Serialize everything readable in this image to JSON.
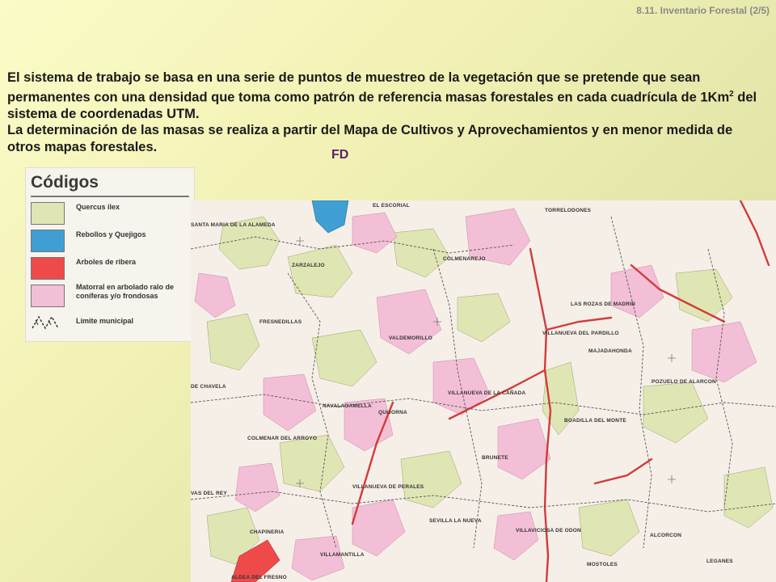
{
  "header": {
    "slide_title": "8.11. Inventario Forestal (2/5)"
  },
  "body": {
    "paragraph1_a": "El sistema de trabajo se basa en una serie de puntos de muestreo de la vegetación que se pretende que sean permanentes con una densidad que toma como patrón de referencia masas forestales en cada cuadrícula de 1Km",
    "paragraph1_sup": "2",
    "paragraph1_b": " del sistema de coordenadas UTM.",
    "paragraph2": "La determinación de las masas se realiza a partir del Mapa de Cultivos y Aprovechamientos y en menor medida  de otros mapas forestales."
  },
  "fd_label": "FD",
  "legend": {
    "title": "Códigos",
    "items": [
      {
        "label": "Quercus ilex",
        "color": "#dfe6b4"
      },
      {
        "label": "Rebollos y Quejigos",
        "color": "#3f9fd2"
      },
      {
        "label": "Arboles de ribera",
        "color": "#ef4a4a"
      },
      {
        "label": "Matorral en arbolado ralo de coníferas y/o frondosas",
        "color": "#f3bfd6"
      },
      {
        "label": "Límite municipal",
        "color": "#333333"
      }
    ]
  },
  "map": {
    "background_color": "#f6efe8",
    "places": [
      "SANTA MARIA DE LA ALAMEDA",
      "EL ESCORIAL",
      "TORRELODONES",
      "ZARZALEJO",
      "COLMENAREJO",
      "LAS ROZAS DE MADRID",
      "FRESNEDILLAS",
      "VALDEMORILLO",
      "VILLANUEVA DEL PARDILLO",
      "MAJADAHONDA",
      "DE CHAVELA",
      "VILLANUEVA DE LA CAÑADA",
      "POZUELO DE ALARCON",
      "NAVALAGAMELLA",
      "QUIJORNA",
      "BOADILLA DEL MONTE",
      "COLMENAR DEL ARROYO",
      "BRUNETE",
      "VAS DEL REY",
      "VILLANUEVA DE PERALES",
      "VILLAVICIOSA DE ODON",
      "ALCORCON",
      "CHAPINERIA",
      "SEVILLA LA NUEVA",
      "LEGANES",
      "VILLAMANTILLA",
      "MOSTOLES",
      "ALDEA DEL FRESNO"
    ]
  }
}
